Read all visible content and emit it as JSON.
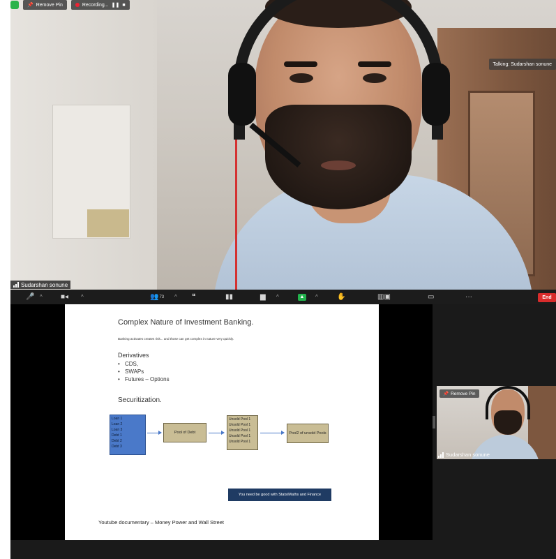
{
  "top_bar": {
    "remove_pin": "Remove Pin",
    "recording": "Recording..."
  },
  "main_video": {
    "talking": "Talking: Sudarshan sonune",
    "speaker_name": "Sudarshan sonune"
  },
  "toolbar": {
    "participants_count": "73",
    "end_label": "End",
    "more_label": "···"
  },
  "slide": {
    "title": "Complex Nature of Investment Banking.",
    "subtitle": "Banking activates creates risk... and those can get complex in nature very quickly.",
    "section1": "Derivatives",
    "bullets": [
      "CDS,",
      "SWAPs",
      "Futures – Options"
    ],
    "section2": "Securitization.",
    "loans": [
      "Loan 1",
      "Loan 2",
      "Loan 3",
      "Debt 1",
      "Debt 2",
      "Debt 3"
    ],
    "pool_of_debt": "Pool of Debt",
    "unsold_pools": [
      "Unsold Pool 1",
      "Unsold Pool 1",
      "Unsold Pool 1",
      "Unsold Pool 1",
      "Unsold Pool 1"
    ],
    "pool2": "Pool2 of unsold Pools",
    "note": "You need be good with Stats/Maths and Finance",
    "footer": "Youtube documentary – Money Power and Wall Street"
  },
  "gallery": {
    "remove_pin": "Remove Pin",
    "name": "Sudarshan sonune"
  },
  "colors": {
    "end_button": "#d82c2c",
    "share_green": "#22b24c",
    "loans_blue": "#4a79c9",
    "note_navy": "#1f3b63"
  }
}
